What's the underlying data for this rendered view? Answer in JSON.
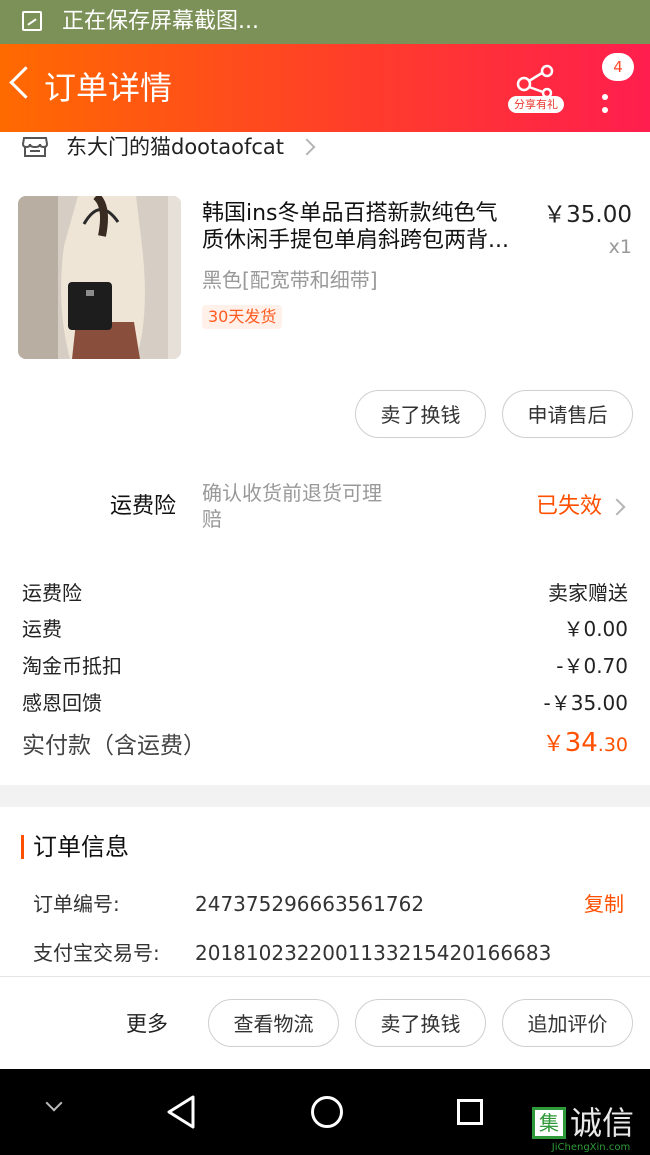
{
  "status_bar": {
    "text": "正在保存屏幕截图..."
  },
  "header": {
    "title": "订单详情",
    "share_label": "分享有礼",
    "badge_count": "4"
  },
  "shop": {
    "name": "东大门的猫dootaofcat"
  },
  "product": {
    "title_line1": "韩国ins冬单品百搭新款纯色气",
    "title_line2": "质休闲手提包单肩斜跨包两背...",
    "price": "￥35.00",
    "quantity": "x1",
    "spec": "黑色[配宽带和细带]",
    "tag": "30天发货",
    "buttons": [
      "卖了换钱",
      "申请售后"
    ]
  },
  "insurance": {
    "label": "运费险",
    "desc_line1": "确认收货前退货可理",
    "desc_line2": "赔",
    "status": "已失效"
  },
  "fees": [
    {
      "label": "运费险",
      "value": "卖家赠送"
    },
    {
      "label": "运费",
      "value": "￥0.00"
    },
    {
      "label": "淘金币抵扣",
      "value": "-￥0.70"
    },
    {
      "label": "感恩回馈",
      "value": "-￥35.00"
    }
  ],
  "total": {
    "label": "实付款（含运费）",
    "currency": "￥",
    "integer": "34",
    "decimal": ".30"
  },
  "order_info": {
    "title": "订单信息",
    "order_no_label": "订单编号:",
    "order_no": "247375296663561762",
    "copy_label": "复制",
    "alipay_label": "支付宝交易号:",
    "alipay_no": "2018102322001133215420166683"
  },
  "bottom_bar": {
    "more_label": "更多",
    "buttons": [
      "查看物流",
      "卖了换钱",
      "追加评价"
    ]
  },
  "watermark": {
    "box_char": "集",
    "text": "诚信",
    "url": "JiChengXin.com"
  },
  "colors": {
    "accent": "#ff5000",
    "header_start": "#ff6a00",
    "header_end": "#ff1e4e",
    "status_bar": "#7c9158"
  }
}
